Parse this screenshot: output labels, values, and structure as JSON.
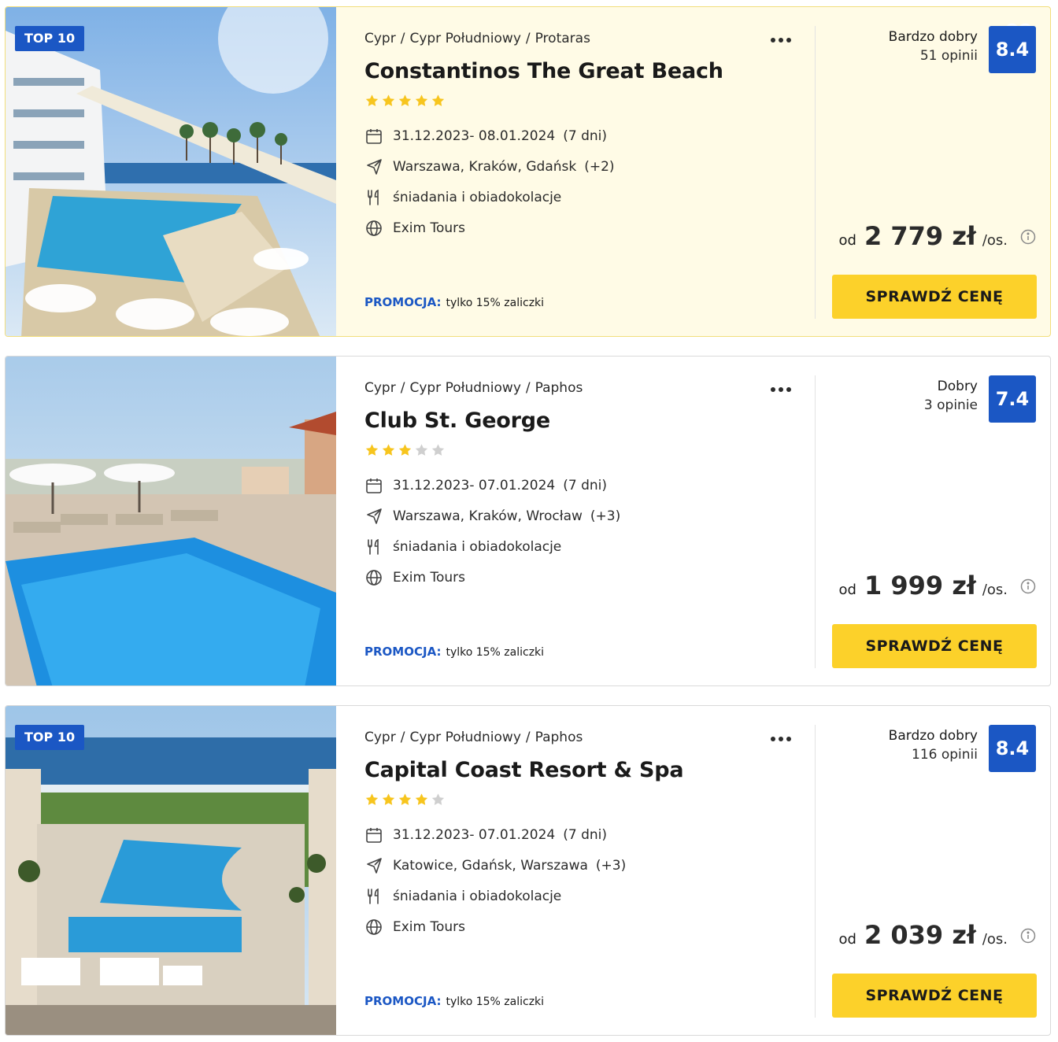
{
  "common": {
    "promo_label": "PROMOCJA:",
    "promo_text": "tylko 15% zaliczki",
    "price_prefix": "od",
    "price_suffix": "/os.",
    "cta_label": "SPRAWDŹ CENĘ",
    "accent_color": "#1b57c4",
    "cta_color": "#fcd12a",
    "star_color": "#f7c51e"
  },
  "offers": [
    {
      "badge": "TOP 10",
      "breadcrumb": [
        "Cypr",
        "Cypr Południowy",
        "Protaras"
      ],
      "name": "Constantinos The Great Beach",
      "stars": 5,
      "dates": "31.12.2023- 08.01.2024",
      "duration": "(7 dni)",
      "departures": "Warszawa, Kraków, Gdańsk",
      "departures_more": "(+2)",
      "board": "śniadania i obiadokolacje",
      "operator": "Exim Tours",
      "rating_label": "Bardzo dobry",
      "reviews": "51 opinii",
      "score": "8.4",
      "price": "2 779 zł",
      "highlighted": true
    },
    {
      "badge": "",
      "breadcrumb": [
        "Cypr",
        "Cypr Południowy",
        "Paphos"
      ],
      "name": "Club St. George",
      "stars": 3,
      "dates": "31.12.2023- 07.01.2024",
      "duration": "(7 dni)",
      "departures": "Warszawa, Kraków, Wrocław",
      "departures_more": "(+3)",
      "board": "śniadania i obiadokolacje",
      "operator": "Exim Tours",
      "rating_label": "Dobry",
      "reviews": "3 opinie",
      "score": "7.4",
      "price": "1 999 zł",
      "highlighted": false
    },
    {
      "badge": "TOP 10",
      "breadcrumb": [
        "Cypr",
        "Cypr Południowy",
        "Paphos"
      ],
      "name": "Capital Coast Resort & Spa",
      "stars": 4,
      "dates": "31.12.2023- 07.01.2024",
      "duration": "(7 dni)",
      "departures": "Katowice, Gdańsk, Warszawa",
      "departures_more": "(+3)",
      "board": "śniadania i obiadokolacje",
      "operator": "Exim Tours",
      "rating_label": "Bardzo dobry",
      "reviews": "116 opinii",
      "score": "8.4",
      "price": "2 039 zł",
      "highlighted": false
    }
  ]
}
